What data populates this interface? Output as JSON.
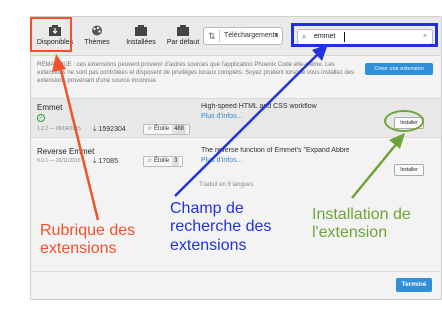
{
  "toolbar": {
    "tabs": [
      {
        "label": "Disponibles",
        "icon": "available-icon"
      },
      {
        "label": "Thèmes",
        "icon": "themes-icon"
      },
      {
        "label": "Installées",
        "icon": "installed-icon"
      },
      {
        "label": "Par défaut",
        "icon": "default-icon"
      }
    ],
    "sort": {
      "value": "Téléchargements"
    },
    "search": {
      "value": "emmet",
      "clear": "×"
    }
  },
  "notice": {
    "text": "REMARQUE : ces extensions peuvent provenir d'autres sources que l'application Phoenix Code elle-même. Les extensions ne sont pas contrôlées et disposent de privilèges locaux complets. Soyez prudent lorsque vous installez des extensions provenant d'une source inconnue.",
    "create_button": "Créer une extension"
  },
  "extensions": [
    {
      "name": "Emmet",
      "meta": "1.2.2 — 06/04/2015",
      "downloads": "1592304",
      "star_label": "Étoile",
      "stars": "488",
      "description": "High-speed HTML and CSS workflow",
      "more": "Plus d'infos...",
      "install_label": "Installer"
    },
    {
      "name": "Reverse Emmet",
      "meta": "0.0.1 — 26/11/2015",
      "downloads": "17085",
      "star_label": "Étoile",
      "stars": "3",
      "description": "The reverse function of Emmet's \"Expand Abbreviation\"",
      "more": "Plus d'infos...",
      "install_label": "Installer"
    }
  ],
  "translated_text": "Traduit en 9 langues",
  "done_button": "Terminé",
  "annotations": {
    "tabs_label": "Rubrique des extensions",
    "search_label": "Champ de recherche des extensions",
    "install_label": "Installation de l'extension"
  },
  "colors": {
    "tabs_annotation": "#f0522c",
    "search_annotation": "#2233dd",
    "install_annotation": "#6ea43a",
    "accent": "#2f8fd9"
  }
}
